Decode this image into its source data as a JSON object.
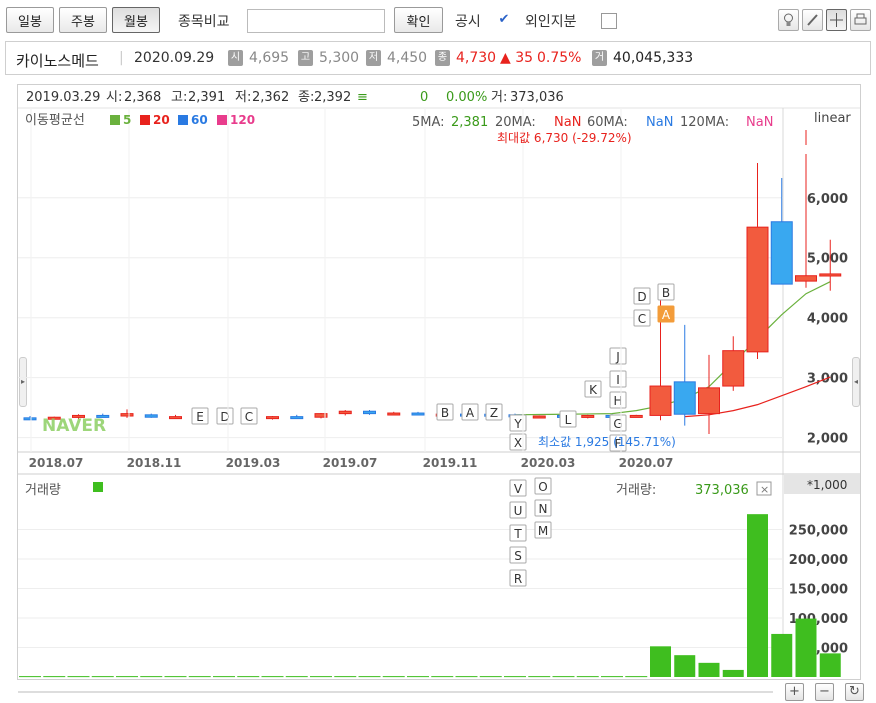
{
  "toolbar": {
    "daily": "일봉",
    "weekly": "주봉",
    "monthly": "월봉",
    "compare_label": "종목비교",
    "compare_placeholder": "",
    "confirm": "확인",
    "disclosure": "공시",
    "disclosure_check": "✔",
    "foreign_label": "외인지분"
  },
  "stock": {
    "name": "카이노스메드",
    "date": "2020.09.29",
    "open_badge": "시",
    "open": "4,695",
    "high_badge": "고",
    "high": "5,300",
    "low_badge": "저",
    "low": "4,450",
    "close_badge": "종",
    "close": "4,730",
    "change": "▲ 35",
    "change_pct": "0.75%",
    "volume_badge": "거",
    "volume": "40,045,333",
    "up_color": "#e8221d"
  },
  "cursor": {
    "date": "2019.03.29",
    "open_label": "시:",
    "open": "2,368",
    "high_label": "고:",
    "high": "2,391",
    "low_label": "저:",
    "low": "2,362",
    "close_label": "종:",
    "close": "2,392",
    "eq": "≡",
    "diff": "0",
    "pct": "0.00%",
    "vol_label": "거:",
    "volume": "373,036"
  },
  "ma": {
    "title": "이동평균선",
    "legend": [
      {
        "label": "5",
        "color": "#6ab13d"
      },
      {
        "label": "20",
        "color": "#e8221d"
      },
      {
        "label": "60",
        "color": "#2a7ae2"
      },
      {
        "label": "120",
        "color": "#e83c8c"
      }
    ],
    "ma5_label": "5MA:",
    "ma5": "2,381",
    "ma20_label": "20MA:",
    "ma20": "NaN",
    "ma60_label": "60MA:",
    "ma60": "NaN",
    "ma120_label": "120MA:",
    "ma120": "NaN"
  },
  "scale_mode": "linear",
  "max_label": "최대값 6,730 (-29.72%)",
  "min_label": "최소값 1,925 (145.71%)",
  "watermark": "NAVER",
  "volume_panel": {
    "title": "거래량",
    "readout_label": "거래량:",
    "readout_value": "373,036",
    "unit": "*1,000"
  },
  "chart_data": [
    {
      "type": "candlestick",
      "x_ticks": [
        "2018.07",
        "2018.11",
        "2019.03",
        "2019.07",
        "2019.11",
        "2020.03",
        "2020.07"
      ],
      "y_ticks": [
        "2,000",
        "3,000",
        "4,000",
        "5,000",
        "6,000"
      ],
      "ylim": [
        1760,
        6880
      ],
      "candles": [
        {
          "o": 2330,
          "h": 2360,
          "l": 2300,
          "c": 2320
        },
        {
          "o": 2320,
          "h": 2350,
          "l": 2300,
          "c": 2340
        },
        {
          "o": 2340,
          "h": 2390,
          "l": 2310,
          "c": 2370
        },
        {
          "o": 2370,
          "h": 2400,
          "l": 2340,
          "c": 2360
        },
        {
          "o": 2360,
          "h": 2470,
          "l": 2330,
          "c": 2400
        },
        {
          "o": 2380,
          "h": 2400,
          "l": 2330,
          "c": 2340
        },
        {
          "o": 2340,
          "h": 2380,
          "l": 2320,
          "c": 2350
        },
        {
          "o": 2350,
          "h": 2370,
          "l": 2320,
          "c": 2340
        },
        {
          "o": 2340,
          "h": 2360,
          "l": 2300,
          "c": 2310
        },
        {
          "o": 2310,
          "h": 2340,
          "l": 2290,
          "c": 2330
        },
        {
          "o": 2320,
          "h": 2360,
          "l": 2300,
          "c": 2350
        },
        {
          "o": 2350,
          "h": 2380,
          "l": 2320,
          "c": 2340
        },
        {
          "o": 2340,
          "h": 2410,
          "l": 2320,
          "c": 2400
        },
        {
          "o": 2400,
          "h": 2460,
          "l": 2370,
          "c": 2440
        },
        {
          "o": 2440,
          "h": 2460,
          "l": 2380,
          "c": 2400
        },
        {
          "o": 2400,
          "h": 2430,
          "l": 2370,
          "c": 2410
        },
        {
          "o": 2410,
          "h": 2430,
          "l": 2380,
          "c": 2400
        },
        {
          "o": 2390,
          "h": 2410,
          "l": 2370,
          "c": 2392
        },
        {
          "o": 2392,
          "h": 2400,
          "l": 2360,
          "c": 2380
        },
        {
          "o": 2390,
          "h": 2410,
          "l": 2370,
          "c": 2380
        },
        {
          "o": 2380,
          "h": 2400,
          "l": 2340,
          "c": 2350
        },
        {
          "o": 2350,
          "h": 2370,
          "l": 2330,
          "c": 2360
        },
        {
          "o": 2370,
          "h": 2390,
          "l": 2330,
          "c": 2340
        },
        {
          "o": 2340,
          "h": 2380,
          "l": 2320,
          "c": 2370
        },
        {
          "o": 2370,
          "h": 2390,
          "l": 2340,
          "c": 2360
        },
        {
          "o": 2360,
          "h": 2380,
          "l": 2340,
          "c": 2370
        },
        {
          "o": 2370,
          "h": 4380,
          "l": 2290,
          "c": 2860
        },
        {
          "o": 2930,
          "h": 3880,
          "l": 2200,
          "c": 2390
        },
        {
          "o": 2400,
          "h": 3380,
          "l": 2060,
          "c": 2830
        },
        {
          "o": 2860,
          "h": 3690,
          "l": 2780,
          "c": 3450
        },
        {
          "o": 3430,
          "h": 6580,
          "l": 3310,
          "c": 5510
        },
        {
          "o": 5600,
          "h": 6330,
          "l": 4560,
          "c": 4560
        },
        {
          "o": 4610,
          "h": 6730,
          "l": 4500,
          "c": 4700
        },
        {
          "o": 4695,
          "h": 5300,
          "l": 4450,
          "c": 4730
        }
      ],
      "ma_lines": [
        {
          "name": "5",
          "color": "#6ab13d",
          "values": [
            2380,
            2385,
            2390,
            2395,
            2400,
            2450,
            2530,
            2650,
            2850,
            3250,
            3650,
            4050,
            4400,
            4600
          ]
        },
        {
          "name": "20",
          "color": "#e8221d",
          "values": [
            2350,
            2380,
            2450,
            2550,
            2700,
            2850,
            3010
          ]
        }
      ],
      "event_flags": [
        "E",
        "D",
        "C",
        "B",
        "A",
        "Z",
        "Y",
        "X",
        "L",
        "K",
        "J",
        "I",
        "H",
        "G",
        "F",
        "D",
        "C",
        "B",
        "A"
      ]
    },
    {
      "type": "bar",
      "title": "거래량",
      "unit": "*1,000",
      "y_ticks": [
        "50,000",
        "100,000",
        "150,000",
        "200,000",
        "250,000"
      ],
      "ylim": [
        0,
        300000
      ],
      "values": [
        1500,
        1500,
        1500,
        1500,
        1500,
        1500,
        1500,
        1500,
        1500,
        1500,
        1500,
        1500,
        1500,
        1500,
        1500,
        1500,
        1500,
        1500,
        1500,
        1500,
        1500,
        1500,
        1500,
        1500,
        1500,
        1500,
        52000,
        37000,
        24000,
        12000,
        276000,
        73000,
        99000,
        40045
      ],
      "bar_color": "#3fbe1f",
      "event_flags": [
        "V",
        "U",
        "T",
        "S",
        "R",
        "O",
        "N",
        "M"
      ]
    }
  ]
}
